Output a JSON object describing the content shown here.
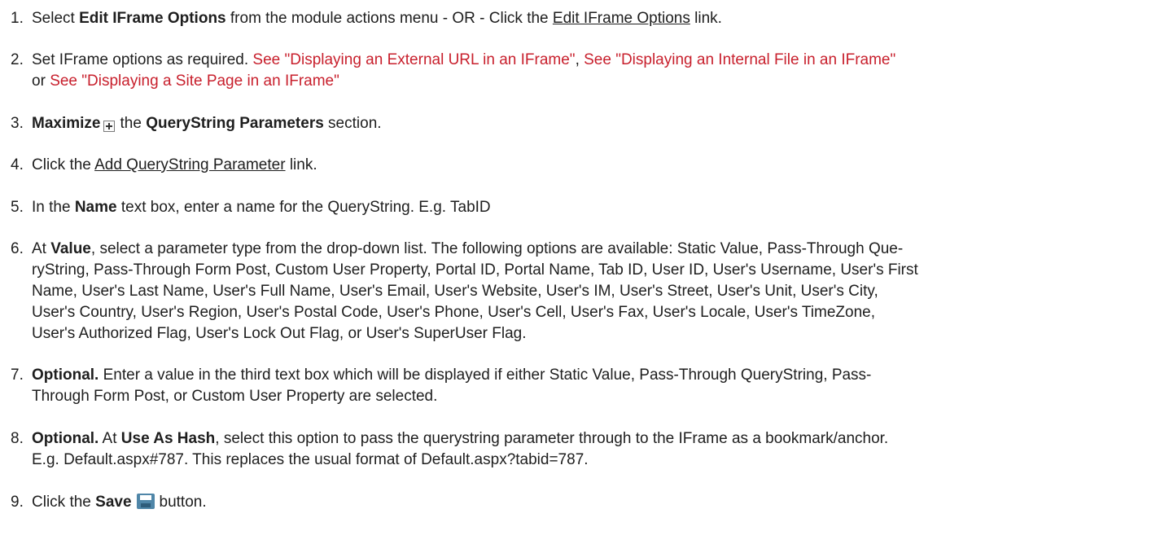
{
  "steps": [
    {
      "num": "1.",
      "p1": "Select ",
      "b1": "Edit IFrame Options",
      "p2": " from the module actions menu - OR - Click the ",
      "link": "Edit IFrame Options",
      "p3": " link."
    },
    {
      "num": "2.",
      "p1": "Set IFrame options as required. ",
      "ref1": "See \"Displaying an External URL in an IFrame\"",
      "sep": ", ",
      "ref2": "See \"Displaying an Internal File in an IFrame\"",
      "or": "or ",
      "ref3": "See \"Displaying a Site Page in an IFrame\""
    },
    {
      "num": "3.",
      "b1": "Maximize",
      "p1": "the ",
      "b2": "QueryString Parameters",
      "p2": " section."
    },
    {
      "num": "4.",
      "p1": "Click the ",
      "link": "Add QueryString Parameter",
      "p2": " link."
    },
    {
      "num": "5.",
      "p1": "In the ",
      "b1": "Name",
      "p2": " text box, enter a name for the QueryString.  E.g. TabID"
    },
    {
      "num": "6.",
      "p1": "At ",
      "b1": "Value",
      "l1": ", select a parameter type from the drop-down list. The following options are available: Static Value, Pass-Through Que-",
      "l2": "ryString, Pass-Through Form Post, Custom User Property, Portal ID, Portal Name, Tab ID, User ID, User's Username, User's First",
      "l3": "Name, User's Last Name, User's Full Name, User's Email, User's Website, User's IM, User's Street, User's Unit, User's City,",
      "l4": "User's Country, User's Region, User's Postal Code, User's Phone, User's Cell, User's Fax, User's Locale, User's TimeZone,",
      "l5": "User's Authorized Flag, User's Lock Out Flag, or User's SuperUser Flag."
    },
    {
      "num": "7.",
      "b1": "Optional.",
      "l1": " Enter a value in the third text box which will be displayed if either Static Value, Pass-Through QueryString, Pass-",
      "l2": "Through Form Post, or Custom User Property are selected."
    },
    {
      "num": "8.",
      "b1": "Optional.",
      "p1": " At ",
      "b2": "Use As Hash",
      "l1": ", select this option to pass the querystring parameter through to the IFrame as a bookmark/anchor.",
      "l2": "E.g. Default.aspx#787. This replaces the usual format of Default.aspx?tabid=787."
    },
    {
      "num": "9.",
      "p1": "Click the ",
      "b1": "Save",
      "p2": "button."
    }
  ],
  "icons": {
    "maximize": "plus-box-icon",
    "save": "floppy-disk-icon"
  },
  "colors": {
    "text": "#1e1e1e",
    "cross_reference": "#c8202d",
    "save_icon": "#4f86a8"
  }
}
